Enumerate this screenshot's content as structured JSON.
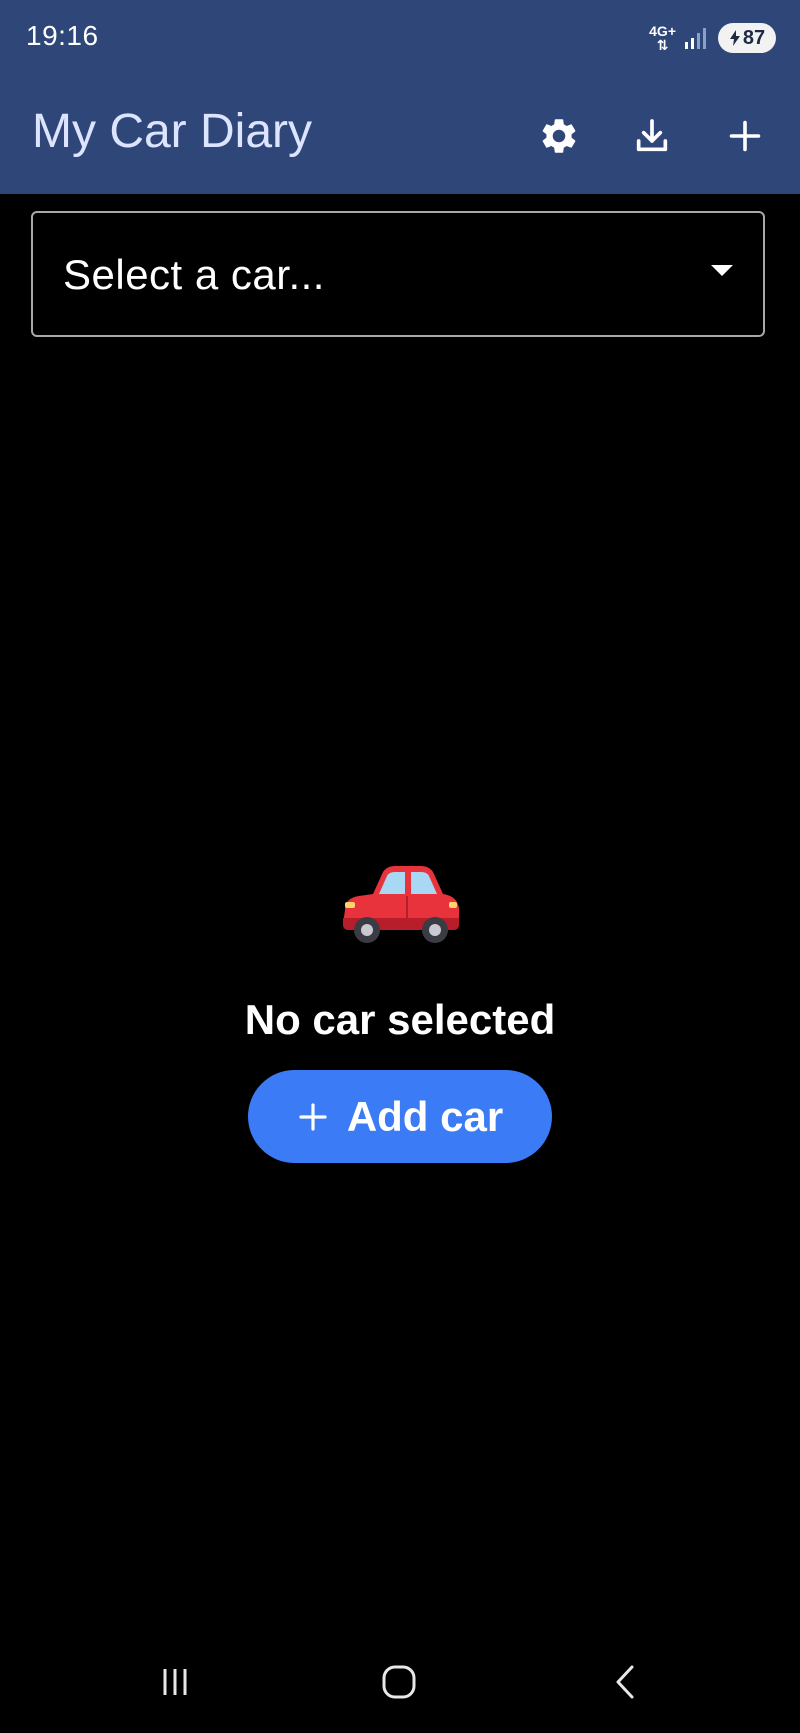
{
  "status_bar": {
    "time": "19:16",
    "network": "4G+",
    "battery": "87"
  },
  "app_bar": {
    "title": "My Car Diary",
    "actions": [
      "gear-icon",
      "download-icon",
      "plus-icon"
    ]
  },
  "car_select": {
    "placeholder": "Select a car..."
  },
  "empty_state": {
    "icon": "car-icon",
    "message": "No car selected",
    "button_label": "Add car"
  },
  "navigation": {
    "items": [
      "recent-apps-icon",
      "home-icon",
      "back-icon"
    ]
  },
  "colors": {
    "app_bar": "#2f4679",
    "title": "#dce4ff",
    "background": "#000000",
    "primary_button": "#3c7bf6",
    "car_body": "#e8323c"
  }
}
